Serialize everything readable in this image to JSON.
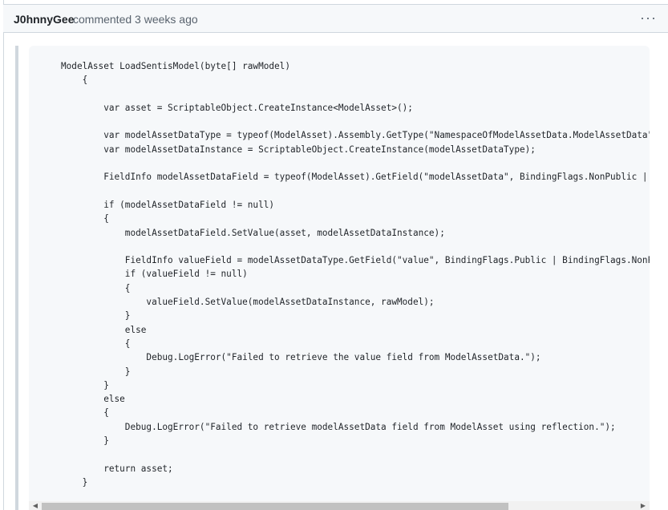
{
  "comment": {
    "author": "J0hnnyGee",
    "action": "commented",
    "time": "3 weeks ago",
    "menu_icon": "···"
  },
  "code": {
    "lines": [
      "ModelAsset LoadSentisModel(byte[] rawModel)",
      "    {",
      "",
      "        var asset = ScriptableObject.CreateInstance<ModelAsset>();",
      "",
      "        var modelAssetDataType = typeof(ModelAsset).Assembly.GetType(\"NamespaceOfModelAssetData.ModelAssetData\");",
      "        var modelAssetDataInstance = ScriptableObject.CreateInstance(modelAssetDataType);",
      "",
      "        FieldInfo modelAssetDataField = typeof(ModelAsset).GetField(\"modelAssetData\", BindingFlags.NonPublic | BindingFlags.Instance);",
      "",
      "        if (modelAssetDataField != null)",
      "        {",
      "            modelAssetDataField.SetValue(asset, modelAssetDataInstance);",
      "",
      "            FieldInfo valueField = modelAssetDataType.GetField(\"value\", BindingFlags.Public | BindingFlags.NonPublic | BindingFlags.Instance);",
      "            if (valueField != null)",
      "            {",
      "                valueField.SetValue(modelAssetDataInstance, rawModel);",
      "            }",
      "            else",
      "            {",
      "                Debug.LogError(\"Failed to retrieve the value field from ModelAssetData.\");",
      "            }",
      "        }",
      "        else",
      "        {",
      "            Debug.LogError(\"Failed to retrieve modelAssetData field from ModelAsset using reflection.\");",
      "        }",
      "",
      "        return asset;",
      "    }"
    ]
  },
  "scrollbar": {
    "left_arrow": "◀",
    "right_arrow": "▶"
  }
}
